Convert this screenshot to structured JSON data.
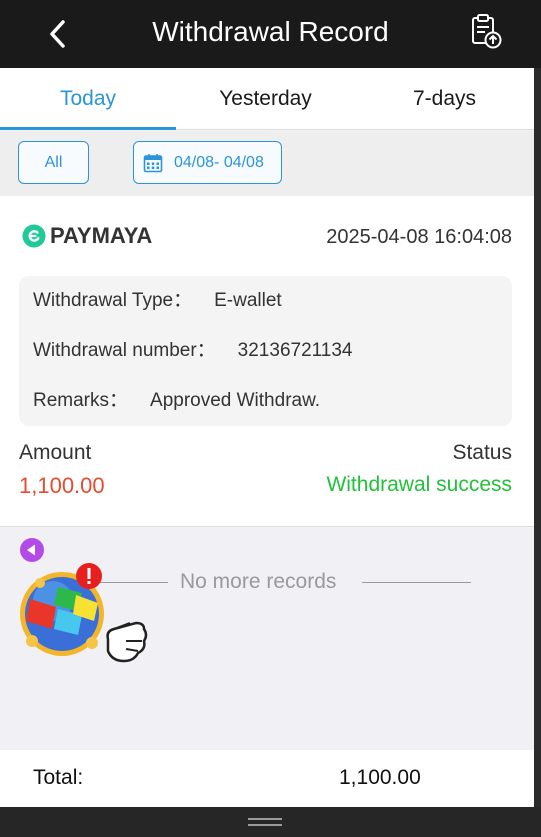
{
  "header": {
    "title": "Withdrawal Record",
    "back_icon": "chevron-left-icon",
    "action_icon": "clipboard-upload-icon"
  },
  "tabs": [
    {
      "label": "Today",
      "active": true
    },
    {
      "label": "Yesterday",
      "active": false
    },
    {
      "label": "7-days",
      "active": false
    }
  ],
  "filters": {
    "all_label": "All",
    "date_range": "04/08- 04/08",
    "date_icon": "calendar-icon"
  },
  "record": {
    "provider": "PAYMAYA",
    "provider_icon": "paymaya-logo-icon",
    "datetime": "2025-04-08 16:04:08",
    "details": [
      {
        "label": "Withdrawal Type：",
        "value": "E-wallet"
      },
      {
        "label": "Withdrawal number：",
        "value": "32136721134"
      },
      {
        "label": "Remarks：",
        "value": "Approved Withdraw."
      }
    ],
    "amount_label": "Amount",
    "amount_value": "1,100.00",
    "status_label": "Status",
    "status_value": "Withdrawal success"
  },
  "no_more_text": "No more records",
  "footer": {
    "total_label": "Total:",
    "total_value": "1,100.00"
  },
  "colors": {
    "accent": "#2a95d8",
    "amount": "#e84a2e",
    "success": "#22c13a",
    "header_bg": "#1a1a1a"
  }
}
